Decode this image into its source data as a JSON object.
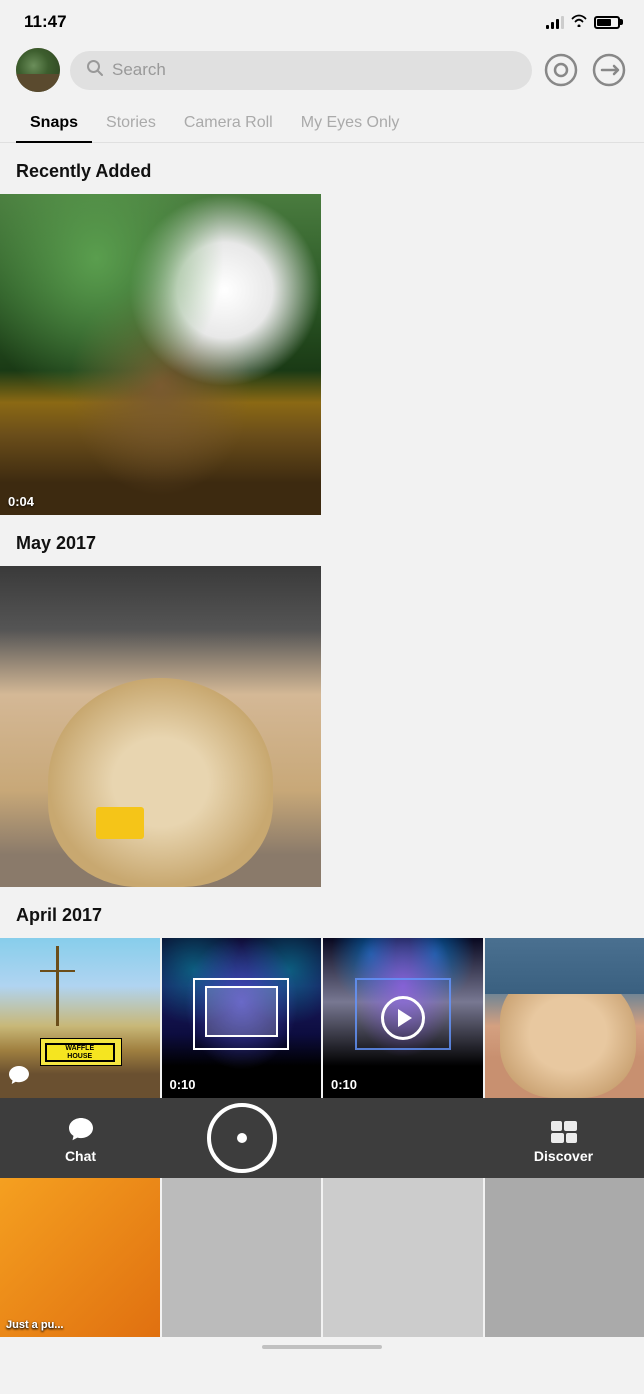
{
  "statusBar": {
    "time": "11:47"
  },
  "header": {
    "searchPlaceholder": "Search",
    "avatarAlt": "User avatar"
  },
  "tabs": [
    {
      "label": "Snaps",
      "active": true
    },
    {
      "label": "Stories",
      "active": false
    },
    {
      "label": "Camera Roll",
      "active": false
    },
    {
      "label": "My Eyes Only",
      "active": false
    }
  ],
  "sections": [
    {
      "title": "Recently Added",
      "snaps": [
        {
          "type": "plant",
          "duration": "0:04",
          "isVideo": true
        }
      ]
    },
    {
      "title": "May 2017",
      "snaps": [
        {
          "type": "dog",
          "duration": null,
          "isVideo": false
        }
      ]
    },
    {
      "title": "April 2017",
      "snaps": [
        {
          "type": "waffle",
          "duration": null,
          "isVideo": false
        },
        {
          "type": "concert1",
          "duration": "0:10",
          "isVideo": true
        },
        {
          "type": "concert2",
          "duration": "0:10",
          "isVideo": true
        },
        {
          "type": "puppy",
          "duration": null,
          "isVideo": false
        }
      ]
    }
  ],
  "bottomNav": {
    "items": [
      {
        "label": "Chat",
        "icon": "chat"
      },
      {
        "label": "",
        "icon": "camera"
      },
      {
        "label": "Discover",
        "icon": "discover"
      }
    ]
  },
  "moreContent": {
    "caption": "Just a pu..."
  }
}
